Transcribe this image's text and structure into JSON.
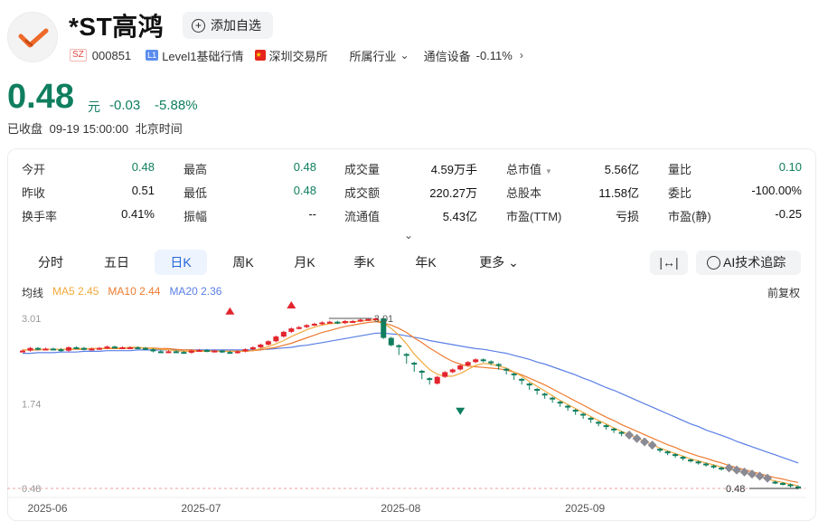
{
  "header": {
    "stock_name": "*ST高鸿",
    "watch_label": "添加自选",
    "market_tag": "SZ",
    "code": "000851",
    "level_tag": "L1",
    "level_text": "Level1基础行情",
    "exchange": "深圳交易所",
    "industry_label": "所属行业",
    "industry_name": "通信设备",
    "industry_change": "-0.11%"
  },
  "quote": {
    "price": "0.48",
    "unit": "元",
    "change": "-0.03",
    "change_pct": "-5.88%",
    "status": "已收盘",
    "datetime": "09-19 15:00:00",
    "timezone": "北京时间"
  },
  "stats": [
    [
      {
        "label": "今开",
        "value": "0.48",
        "green": true
      },
      {
        "label": "最高",
        "value": "0.48",
        "green": true
      },
      {
        "label": "成交量",
        "value": "4.59万手"
      },
      {
        "label": "总市值",
        "value": "5.56亿",
        "dropdown": true
      },
      {
        "label": "量比",
        "value": "0.10",
        "green": true
      }
    ],
    [
      {
        "label": "昨收",
        "value": "0.51"
      },
      {
        "label": "最低",
        "value": "0.48",
        "green": true
      },
      {
        "label": "成交额",
        "value": "220.27万"
      },
      {
        "label": "总股本",
        "value": "11.58亿"
      },
      {
        "label": "委比",
        "value": "-100.00%"
      }
    ],
    [
      {
        "label": "换手率",
        "value": "0.41%"
      },
      {
        "label": "振幅",
        "value": "--"
      },
      {
        "label": "流通值",
        "value": "5.43亿"
      },
      {
        "label": "市盈(TTM)",
        "value": "亏损"
      },
      {
        "label": "市盈(静)",
        "value": "-0.25"
      }
    ]
  ],
  "tabs": [
    "分时",
    "五日",
    "日K",
    "周K",
    "月K",
    "季K",
    "年K",
    "更多"
  ],
  "active_tab": "日K",
  "tools": {
    "range_icon": "range-icon",
    "ai_label": "AI技术追踪"
  },
  "legend": {
    "ma_label": "均线",
    "ma5": "MA5 2.45",
    "ma10": "MA10 2.44",
    "ma20": "MA20 2.36",
    "adjust": "前复权"
  },
  "colors": {
    "up": "#e2252e",
    "down": "#0f7e5f",
    "ma5": "#f2a93b",
    "ma10": "#ee7b30",
    "ma20": "#5a7fe6",
    "active_tab": "#2465d9"
  },
  "chart_data": {
    "type": "candlestick",
    "y_ticks": [
      "3.01",
      "1.74",
      "0.48"
    ],
    "x_ticks": [
      "2025-06",
      "2025-07",
      "2025-08",
      "2025-09"
    ],
    "high_label": "3.01",
    "last_label": "0.48",
    "ylim": [
      0.48,
      3.01
    ],
    "closes": [
      2.53,
      2.57,
      2.55,
      2.56,
      2.55,
      2.53,
      2.58,
      2.57,
      2.55,
      2.56,
      2.57,
      2.59,
      2.58,
      2.58,
      2.58,
      2.57,
      2.55,
      2.52,
      2.51,
      2.52,
      2.51,
      2.5,
      2.53,
      2.54,
      2.52,
      2.53,
      2.51,
      2.5,
      2.52,
      2.55,
      2.58,
      2.62,
      2.67,
      2.74,
      2.81,
      2.86,
      2.88,
      2.91,
      2.93,
      2.95,
      2.96,
      2.94,
      2.97,
      2.97,
      2.99,
      3.0,
      3.01,
      2.72,
      2.61,
      2.48,
      2.35,
      2.23,
      2.12,
      2.04,
      2.14,
      2.21,
      2.25,
      2.31,
      2.36,
      2.4,
      2.37,
      2.33,
      2.26,
      2.19,
      2.11,
      2.04,
      1.96,
      1.89,
      1.83,
      1.77,
      1.71,
      1.65,
      1.59,
      1.53,
      1.47,
      1.42,
      1.37,
      1.32,
      1.27,
      1.22,
      1.17,
      1.12,
      1.07,
      1.03,
      0.99,
      0.95,
      0.91,
      0.88,
      0.85,
      0.82,
      0.79,
      0.76,
      0.73,
      0.7,
      0.67,
      0.64,
      0.61,
      0.58,
      0.56,
      0.54,
      0.51,
      0.48
    ],
    "ma5": [
      2.54,
      2.54,
      2.55,
      2.55,
      2.55,
      2.55,
      2.55,
      2.56,
      2.56,
      2.56,
      2.56,
      2.57,
      2.57,
      2.57,
      2.58,
      2.58,
      2.57,
      2.56,
      2.55,
      2.54,
      2.53,
      2.52,
      2.52,
      2.52,
      2.52,
      2.52,
      2.52,
      2.52,
      2.52,
      2.52,
      2.53,
      2.56,
      2.59,
      2.63,
      2.68,
      2.74,
      2.79,
      2.84,
      2.88,
      2.91,
      2.93,
      2.94,
      2.95,
      2.96,
      2.97,
      2.98,
      2.99,
      2.94,
      2.86,
      2.76,
      2.63,
      2.48,
      2.36,
      2.25,
      2.18,
      2.15,
      2.15,
      2.19,
      2.25,
      2.31,
      2.34,
      2.33,
      2.3,
      2.27,
      2.21,
      2.15,
      2.07,
      2.0,
      1.93,
      1.86,
      1.79,
      1.73,
      1.67,
      1.61,
      1.55,
      1.49,
      1.44,
      1.38,
      1.33,
      1.28,
      1.23,
      1.18,
      1.13,
      1.08,
      1.04,
      1.0,
      0.96,
      0.92,
      0.89,
      0.86,
      0.83,
      0.8,
      0.77,
      0.74,
      0.71,
      0.68,
      0.65,
      0.62,
      0.59,
      0.57,
      0.54,
      0.52
    ],
    "ma10": [
      2.54,
      2.54,
      2.54,
      2.55,
      2.55,
      2.55,
      2.55,
      2.55,
      2.55,
      2.56,
      2.56,
      2.56,
      2.56,
      2.56,
      2.57,
      2.57,
      2.57,
      2.57,
      2.56,
      2.56,
      2.55,
      2.54,
      2.54,
      2.53,
      2.53,
      2.52,
      2.52,
      2.52,
      2.52,
      2.52,
      2.53,
      2.54,
      2.56,
      2.58,
      2.61,
      2.64,
      2.68,
      2.72,
      2.76,
      2.8,
      2.83,
      2.86,
      2.89,
      2.91,
      2.93,
      2.95,
      2.96,
      2.94,
      2.91,
      2.86,
      2.8,
      2.72,
      2.65,
      2.57,
      2.5,
      2.43,
      2.37,
      2.33,
      2.3,
      2.29,
      2.28,
      2.27,
      2.26,
      2.24,
      2.21,
      2.17,
      2.12,
      2.07,
      2.02,
      1.96,
      1.9,
      1.84,
      1.78,
      1.72,
      1.66,
      1.6,
      1.54,
      1.49,
      1.43,
      1.38,
      1.33,
      1.28,
      1.23,
      1.18,
      1.13,
      1.09,
      1.04,
      1.0,
      0.96,
      0.93,
      0.89,
      0.86,
      0.82,
      0.79,
      0.76,
      0.73,
      0.7,
      0.67,
      0.64,
      0.62,
      0.59,
      0.57
    ],
    "ma20": [
      2.49,
      2.49,
      2.5,
      2.5,
      2.5,
      2.51,
      2.51,
      2.51,
      2.52,
      2.52,
      2.52,
      2.53,
      2.53,
      2.53,
      2.53,
      2.54,
      2.54,
      2.54,
      2.54,
      2.54,
      2.54,
      2.54,
      2.54,
      2.54,
      2.54,
      2.54,
      2.54,
      2.54,
      2.54,
      2.54,
      2.54,
      2.55,
      2.55,
      2.56,
      2.57,
      2.58,
      2.6,
      2.61,
      2.63,
      2.65,
      2.67,
      2.69,
      2.71,
      2.73,
      2.75,
      2.77,
      2.79,
      2.79,
      2.78,
      2.77,
      2.75,
      2.73,
      2.71,
      2.68,
      2.66,
      2.64,
      2.62,
      2.6,
      2.58,
      2.56,
      2.55,
      2.53,
      2.51,
      2.49,
      2.46,
      2.43,
      2.4,
      2.36,
      2.33,
      2.29,
      2.25,
      2.21,
      2.17,
      2.12,
      2.08,
      2.03,
      1.98,
      1.94,
      1.89,
      1.84,
      1.79,
      1.74,
      1.69,
      1.64,
      1.59,
      1.54,
      1.49,
      1.44,
      1.4,
      1.35,
      1.31,
      1.27,
      1.23,
      1.18,
      1.14,
      1.1,
      1.06,
      1.02,
      0.98,
      0.94,
      0.9,
      0.86
    ],
    "diamond_days": [
      79,
      80,
      81,
      82,
      92,
      93,
      94,
      95,
      96,
      97
    ],
    "up_markers": [
      [
        27,
        2.92
      ],
      [
        35,
        3.01
      ]
    ],
    "down_markers": [
      [
        57,
        1.64
      ]
    ]
  }
}
